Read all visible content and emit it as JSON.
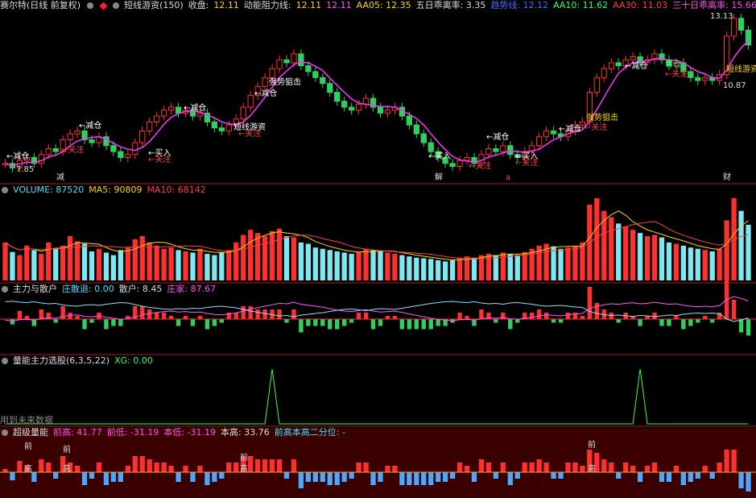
{
  "header": {
    "stock_name": "赛尔特(日线 前复权)",
    "indicator_name": "短线游资(150)",
    "close_label": "收盘:",
    "close_value": "12.11",
    "resist_label": "动能阻力线:",
    "resist_value1": "12.11",
    "resist_value2": "12.11",
    "aa05": "AA05: 12.35",
    "deviation5": "五日乖离率: 3.35",
    "trend_label": "趋势线: 12.12",
    "aa10": "AA10: 11.62",
    "aa30": "AA30: 11.03",
    "deviation30": "三十日乖离率: 15.66"
  },
  "main_panel": {
    "price_high": "13.13",
    "price_low": "7.85",
    "price_right": "10.87",
    "markers": [
      "减",
      "解",
      "a",
      "财"
    ],
    "annotations": [
      {
        "text": "←减仓",
        "color": "#ffffff"
      },
      {
        "text": "←关注",
        "color": "#ff3b3b"
      },
      {
        "text": "←买入",
        "color": "#ffffff"
      },
      {
        "text": "强势狙击",
        "color": "#ffffff"
      },
      {
        "text": "短线游资",
        "color": "#ffffff"
      },
      {
        "text": "青仓",
        "color": "#33ff66"
      },
      {
        "text": "强势狙击",
        "color": "#ffd700"
      },
      {
        "text": "短线游资",
        "color": "#ffd700"
      }
    ]
  },
  "volume_panel": {
    "label": "VOLUME: 87520",
    "ma5": "MA5: 90809",
    "ma10": "MA10: 68142"
  },
  "flow_panel": {
    "label": "主力与散户",
    "s1": "庄散退: 0.00",
    "s2": "散户: 8.45",
    "s3": "庄家: 87.67"
  },
  "select_panel": {
    "label": "量能主力选股(6,3,5,22)",
    "xg": "XG: 0.00",
    "future_note": "用到未来数据"
  },
  "energy_panel": {
    "label": "超级量能",
    "qiangao": "前高: 41.77",
    "qiandi": "前低: -31.19",
    "bendi": "本低: -31.19",
    "bengao": "本高: 33.76",
    "fenwei": "前高本高二分位: -",
    "markers": [
      "前",
      "高",
      "前",
      "高",
      "前",
      "高",
      "前",
      "高"
    ]
  },
  "chart_data": {
    "type": "candlestick",
    "price_axis": {
      "min": 7.85,
      "max": 13.13
    },
    "close": [
      8.1,
      7.95,
      8.2,
      8.3,
      8.1,
      8.4,
      8.6,
      8.5,
      8.9,
      9.1,
      9.2,
      8.9,
      8.8,
      9.0,
      8.7,
      8.5,
      8.3,
      8.4,
      8.8,
      9.2,
      9.5,
      9.7,
      9.9,
      10.0,
      9.8,
      9.9,
      9.7,
      9.8,
      9.5,
      9.3,
      9.2,
      9.4,
      9.6,
      10.0,
      10.4,
      10.7,
      11.0,
      11.3,
      11.6,
      11.5,
      11.8,
      11.4,
      11.2,
      11.0,
      10.8,
      10.5,
      10.2,
      10.0,
      9.9,
      10.1,
      10.3,
      10.0,
      9.8,
      9.9,
      10.0,
      9.7,
      9.4,
      9.1,
      8.8,
      8.5,
      8.3,
      8.1,
      8.0,
      8.2,
      8.3,
      8.1,
      8.4,
      8.6,
      8.5,
      8.7,
      8.4,
      8.3,
      8.5,
      8.7,
      9.0,
      9.2,
      9.1,
      9.0,
      9.2,
      9.4,
      9.5,
      10.5,
      11.0,
      11.3,
      11.5,
      11.4,
      11.6,
      11.7,
      11.5,
      11.6,
      11.8,
      11.6,
      11.4,
      11.5,
      11.2,
      11.0,
      10.9,
      11.0,
      10.9,
      11.1,
      12.4,
      13.0,
      12.6,
      12.1
    ],
    "volume": [
      60,
      45,
      40,
      55,
      48,
      42,
      60,
      50,
      55,
      70,
      62,
      58,
      46,
      50,
      44,
      40,
      48,
      52,
      65,
      70,
      60,
      55,
      50,
      52,
      48,
      46,
      44,
      50,
      42,
      40,
      45,
      48,
      60,
      72,
      80,
      75,
      70,
      78,
      82,
      70,
      68,
      60,
      58,
      52,
      50,
      48,
      46,
      44,
      42,
      45,
      50,
      48,
      46,
      44,
      42,
      40,
      38,
      36,
      35,
      34,
      32,
      30,
      32,
      35,
      38,
      36,
      40,
      42,
      40,
      44,
      42,
      40,
      45,
      50,
      55,
      58,
      54,
      50,
      52,
      55,
      60,
      120,
      130,
      110,
      100,
      90,
      85,
      80,
      75,
      70,
      72,
      68,
      60,
      58,
      55,
      52,
      50,
      48,
      46,
      50,
      95,
      130,
      110,
      88
    ],
    "xg_peaks": [
      37,
      88
    ]
  }
}
